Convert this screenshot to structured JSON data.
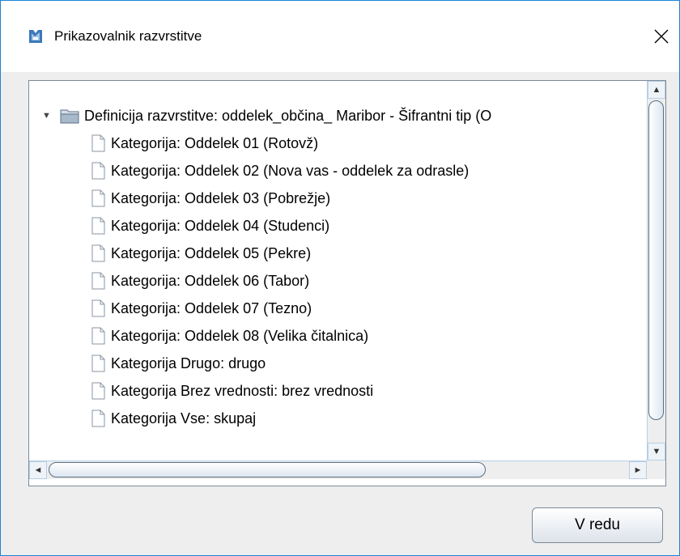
{
  "window": {
    "title": "Prikazovalnik razvrstitve",
    "close_label": "×",
    "app_icon": "app-logo-icon",
    "accent_color": "#1883d7"
  },
  "tree": {
    "root": {
      "label": "Definicija razvrstitve: oddelek_občina_ Maribor - Šifrantni tip (O",
      "toggle": "▼",
      "expanded": true,
      "icon": "folder-icon"
    },
    "children": [
      {
        "label": "Kategorija: Oddelek 01 (Rotovž)",
        "icon": "document-icon"
      },
      {
        "label": "Kategorija: Oddelek 02 (Nova vas - oddelek za odrasle)",
        "icon": "document-icon"
      },
      {
        "label": "Kategorija: Oddelek 03 (Pobrežje)",
        "icon": "document-icon"
      },
      {
        "label": "Kategorija: Oddelek 04 (Studenci)",
        "icon": "document-icon"
      },
      {
        "label": "Kategorija: Oddelek 05 (Pekre)",
        "icon": "document-icon"
      },
      {
        "label": "Kategorija: Oddelek 06 (Tabor)",
        "icon": "document-icon"
      },
      {
        "label": "Kategorija: Oddelek 07 (Tezno)",
        "icon": "document-icon"
      },
      {
        "label": "Kategorija: Oddelek 08 (Velika čitalnica)",
        "icon": "document-icon"
      },
      {
        "label": "Kategorija Drugo: drugo",
        "icon": "document-icon"
      },
      {
        "label": "Kategorija Brez vrednosti: brez vrednosti",
        "icon": "document-icon"
      },
      {
        "label": "Kategorija Vse: skupaj",
        "icon": "document-icon"
      }
    ]
  },
  "scrollbars": {
    "up_arrow": "▲",
    "down_arrow": "▼",
    "left_arrow": "◄",
    "right_arrow": "►"
  },
  "buttons": {
    "ok_label": "V redu"
  }
}
